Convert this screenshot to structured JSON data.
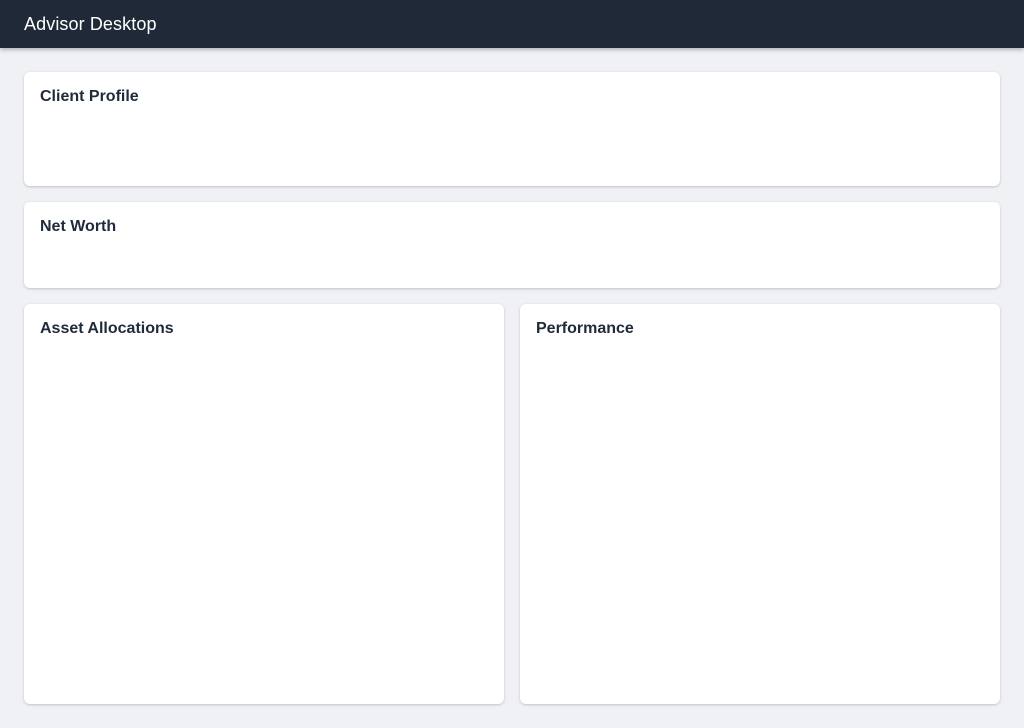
{
  "app": {
    "title": "Advisor Desktop"
  },
  "cards": {
    "client_profile": {
      "title": "Client Profile"
    },
    "net_worth": {
      "title": "Net Worth"
    },
    "asset_allocations": {
      "title": "Asset Allocations"
    },
    "performance": {
      "title": "Performance"
    }
  },
  "colors": {
    "app_bar_background": "#202938",
    "page_background": "#f0f1f5",
    "card_background": "#ffffff",
    "title_text": "#1f2a3a"
  }
}
